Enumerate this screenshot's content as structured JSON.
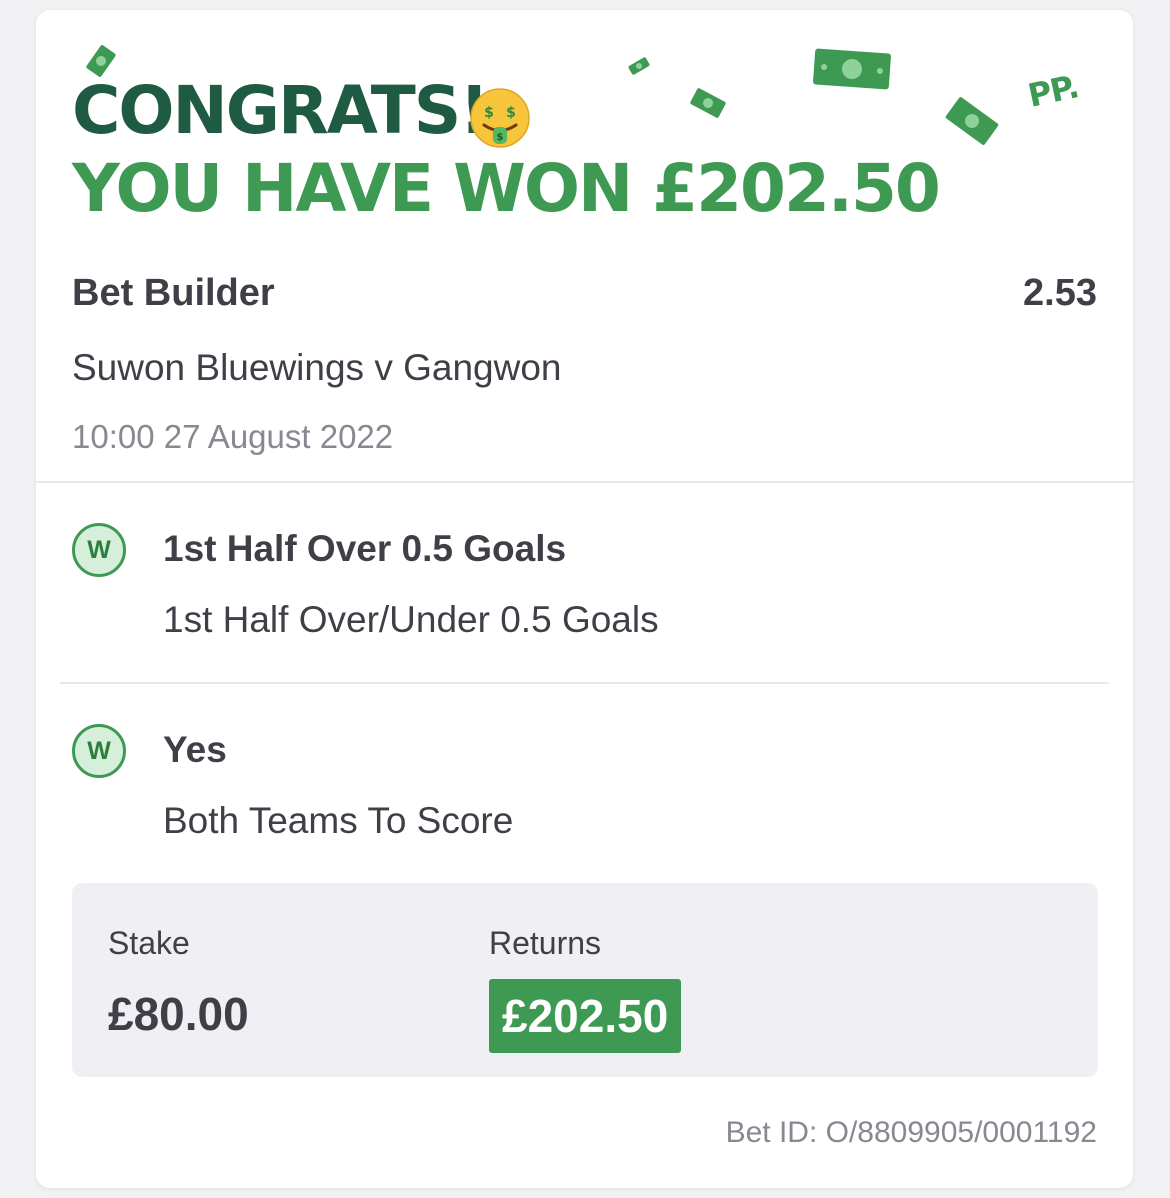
{
  "banner": {
    "congrats": "CONGRATS!",
    "won": "YOU HAVE WON £202.50",
    "emoji": "money-mouth-face",
    "logo": "PP."
  },
  "bet": {
    "type": "Bet Builder",
    "odds": "2.53",
    "match": "Suwon Bluewings v Gangwon",
    "date": "10:00 27 August 2022"
  },
  "selections": [
    {
      "badge": "W",
      "title": "1st Half Over 0.5 Goals",
      "market": "1st Half Over/Under 0.5 Goals"
    },
    {
      "badge": "W",
      "title": "Yes",
      "market": "Both Teams To Score"
    }
  ],
  "summary": {
    "stake_label": "Stake",
    "stake_value": "£80.00",
    "returns_label": "Returns",
    "returns_value": "£202.50"
  },
  "bet_id": "Bet ID: O/8809905/0001192",
  "colors": {
    "dark_green": "#1f5a43",
    "brand_green": "#3e9a52",
    "text": "#3f3f48",
    "muted": "#888890",
    "summary_bg": "#f0f0f4"
  }
}
